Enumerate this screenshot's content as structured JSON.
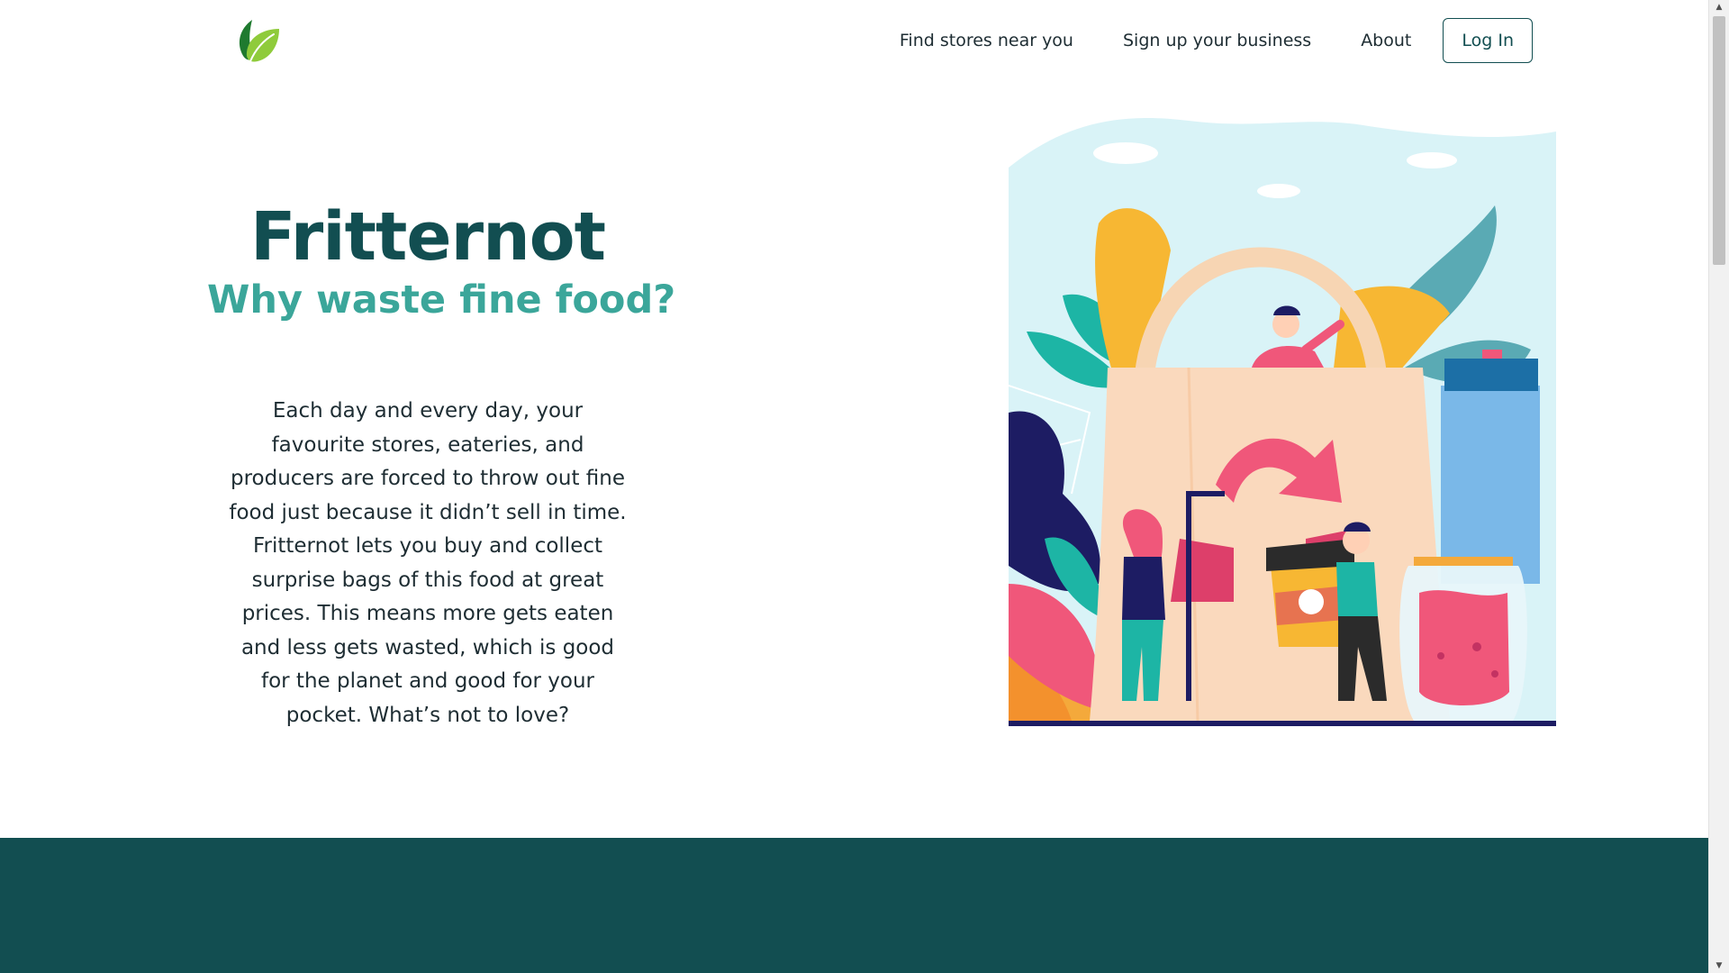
{
  "header": {
    "logo_icon": "leaf-logo-icon",
    "nav": {
      "find_stores": "Find stores near you",
      "sign_up_business": "Sign up your business",
      "about": "About",
      "login": "Log In"
    }
  },
  "hero": {
    "title": "Fritternot",
    "subtitle": "Why waste fine food?",
    "body": "Each day and every day, your favourite stores, eateries, and producers are forced to throw out fine food just because it didn’t sell in time. Fritternot lets you buy and collect surprise bags of this food at great prices. This means more gets eaten and less gets wasted, which is good for the planet and good for your pocket. What’s not to love?",
    "illustration_icon": "shopping-bag-illustration"
  },
  "colors": {
    "brand_dark": "#124e51",
    "brand_teal": "#3ba69a",
    "text": "#1e2d33"
  }
}
